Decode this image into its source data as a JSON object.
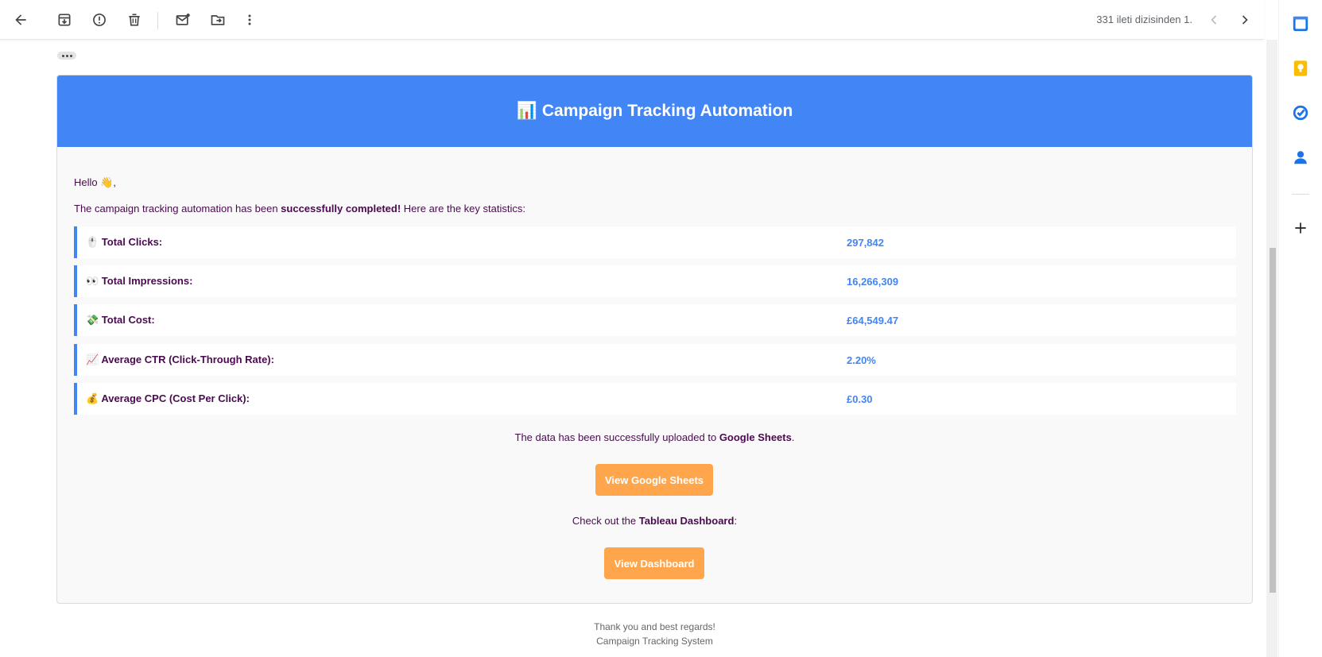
{
  "toolbar": {
    "pager_text": "331 ileti dizisinden 1."
  },
  "email": {
    "banner_icon": "📊",
    "banner_title": "Campaign Tracking Automation",
    "greeting": "Hello 👋,",
    "intro_prefix": "The campaign tracking automation has been ",
    "intro_bold": "successfully completed!",
    "intro_suffix": " Here are the key statistics:",
    "stats": [
      {
        "label": "🖱️ Total Clicks:",
        "value": "297,842"
      },
      {
        "label": "👀 Total Impressions:",
        "value": "16,266,309"
      },
      {
        "label": "💸 Total Cost:",
        "value": "£64,549.47"
      },
      {
        "label": "📈 Average CTR (Click-Through Rate):",
        "value": "2.20%"
      },
      {
        "label": "💰 Average CPC (Cost Per Click):",
        "value": "£0.30"
      }
    ],
    "sheets_prefix": "The data has been successfully uploaded to ",
    "sheets_bold": "Google Sheets",
    "sheets_suffix": ".",
    "sheets_button": "View Google Sheets",
    "tableau_prefix": "Check out the ",
    "tableau_bold": "Tableau Dashboard",
    "tableau_suffix": ":",
    "dashboard_button": "View Dashboard"
  },
  "footer": {
    "line1": "Thank you and best regards!",
    "line2": "Campaign Tracking System"
  },
  "side_panel": {
    "calendar_day": "31"
  },
  "colors": {
    "banner": "#4285f4",
    "button": "#ffa64d",
    "text": "#4a0a4f"
  }
}
